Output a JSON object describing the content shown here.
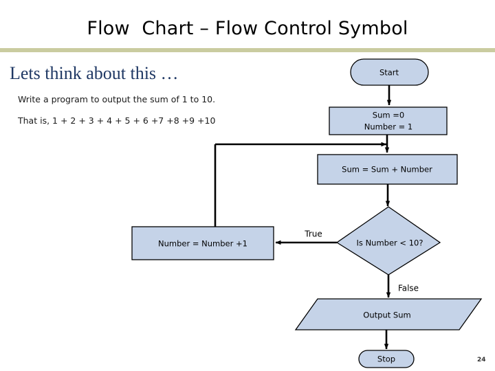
{
  "slide": {
    "title": "Flow  Chart – Flow Control Symbol",
    "page_number": "24",
    "divider_color": "#cacca0",
    "title_color": "#000000"
  },
  "left_panel": {
    "heading": "Lets think about this …",
    "heading_color": "#1f3864",
    "lines": [
      "Write a program to output the sum of 1 to 10.",
      "That is,  1 + 2 + 3 + 4 + 5 + 6 +7 +8 +9 +10"
    ]
  },
  "flowchart": {
    "shape_fill": "#c5d3e8",
    "shape_stroke": "#000000",
    "connector_color": "#000000",
    "nodes": [
      {
        "id": "start",
        "shape": "terminator",
        "label": "Start"
      },
      {
        "id": "init",
        "shape": "process",
        "label_line_1": "Sum =0",
        "label_line_2": "Number = 1"
      },
      {
        "id": "accumulate",
        "shape": "process",
        "label": "Sum = Sum + Number"
      },
      {
        "id": "decision",
        "shape": "decision",
        "label": "Is Number < 10?"
      },
      {
        "id": "increment",
        "shape": "process",
        "label": "Number = Number +1"
      },
      {
        "id": "output",
        "shape": "parallelogram",
        "label": "Output Sum"
      },
      {
        "id": "stop",
        "shape": "terminator",
        "label": "Stop"
      }
    ],
    "edge_labels": [
      {
        "id": "true-label",
        "label": "True"
      },
      {
        "id": "false-label",
        "label": "False"
      }
    ]
  }
}
